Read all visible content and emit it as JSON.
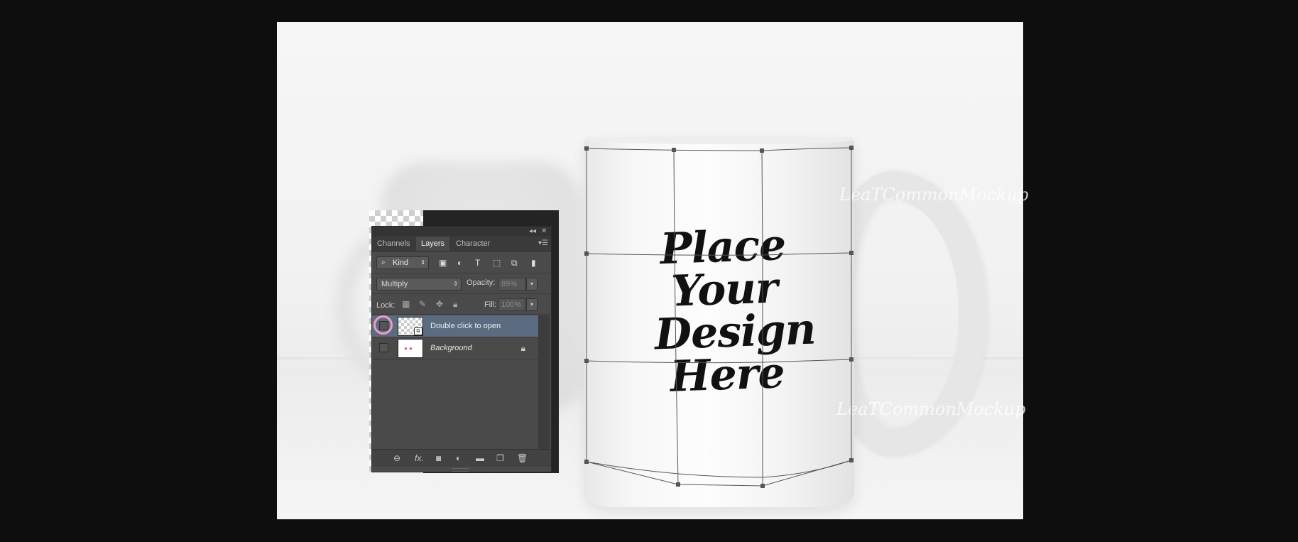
{
  "mockup": {
    "design_lines": [
      "Place",
      "Your",
      "Design",
      "Here"
    ],
    "watermark": "LeaTCommonMockup"
  },
  "panel": {
    "tabs": [
      {
        "label": "Channels",
        "active": false
      },
      {
        "label": "Layers",
        "active": true
      },
      {
        "label": "Character",
        "active": false
      }
    ],
    "filter": {
      "kind_label": "Kind"
    },
    "blend_mode": "Multiply",
    "opacity_label": "Opacity:",
    "opacity_value": "89%",
    "lock_label": "Lock:",
    "fill_label": "Fill:",
    "fill_value": "100%",
    "layers": [
      {
        "name": "Double click to open",
        "selected": true
      },
      {
        "name": "Background",
        "selected": false
      }
    ]
  },
  "colors": {
    "annotation_circle": "#f39bc2",
    "selected_layer": "#5b6b80"
  }
}
